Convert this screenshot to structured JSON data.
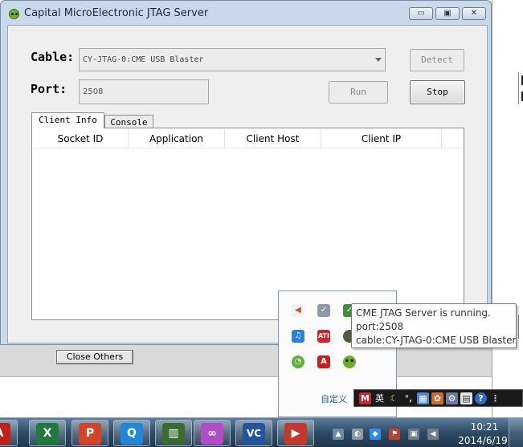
{
  "window": {
    "title": "Capital MicroElectronic JTAG Server",
    "controls": {
      "minimize": "▭",
      "maximize": "▣",
      "close": "✕"
    }
  },
  "form": {
    "cable_label": "Cable:",
    "cable_value": "CY-JTAG-0:CME USB Blaster",
    "port_label": "Port:",
    "port_value": "2508"
  },
  "buttons": {
    "detect": "Detect",
    "run": "Run",
    "stop": "Stop"
  },
  "tabs": [
    {
      "label": "Client Info"
    },
    {
      "label": "Console"
    }
  ],
  "grid": {
    "columns": [
      "Socket ID",
      "Application",
      "Client Host",
      "Client IP"
    ]
  },
  "background": {
    "close_others": "Close Others"
  },
  "tray_popup": {
    "customize_link": "自定义"
  },
  "tooltip": {
    "line1": "CME JTAG Server is running.",
    "line2": "port:2508",
    "line3": "cable:CY-JTAG-0:CME USB Blaster"
  },
  "ime": {
    "mode": "英"
  },
  "taskbar": {
    "time": "10:21",
    "date": "2014/6/19",
    "apps": [
      {
        "name": "acrobat",
        "glyph": "A",
        "color": "#c0211b"
      },
      {
        "name": "excel",
        "glyph": "X",
        "color": "#1f7a3c"
      },
      {
        "name": "powerpoint",
        "glyph": "P",
        "color": "#d24625"
      },
      {
        "name": "qq",
        "glyph": "Q",
        "color": "#1f88d8"
      },
      {
        "name": "terminal",
        "glyph": "▥",
        "color": "#3b6b2e"
      },
      {
        "name": "visual-studio",
        "glyph": "∞",
        "color": "#b04cc8"
      },
      {
        "name": "vnc",
        "glyph": "VC",
        "color": "#2155a0"
      },
      {
        "name": "presentation",
        "glyph": "▶",
        "color": "#c23b2a"
      }
    ]
  },
  "colors": {
    "window_frame": "#c9d8ea",
    "client_bg": "#efefef",
    "tooltip_bg": "#fdfdfd",
    "taskbar": "#2e4a64",
    "link": "#1e5fb4"
  }
}
